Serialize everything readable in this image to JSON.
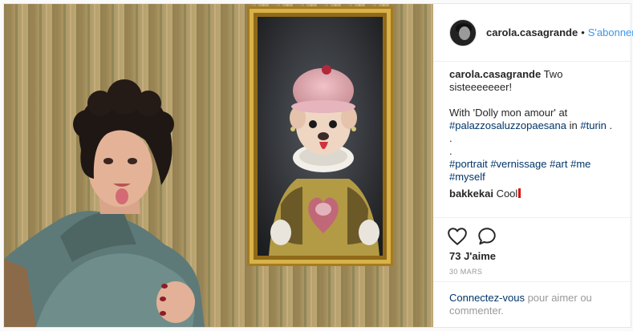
{
  "post": {
    "username": "carola.casagrande",
    "separator": "•",
    "follow_label": "S'abonner",
    "caption": {
      "username": "carola.casagrande",
      "text": "Two sisteeeeeeer!",
      "line2_prefix": "With 'Dolly mon amour' at",
      "tag_location": "#palazzosaluzzopaesana",
      "in_word": "in",
      "tag_city": "#turin",
      "period": ".",
      "dot1": ".",
      "dot2": ".",
      "hashtags": [
        "#portrait",
        "#vernissage",
        "#art",
        "#me",
        "#myself"
      ]
    },
    "comment": {
      "username": "bakkekai",
      "text": "Cool"
    },
    "likes": "73 J'aime",
    "date": "30 MARS",
    "login_prompt": {
      "link": "Connectez-vous",
      "rest": " pour aimer ou commenter."
    }
  },
  "icons": {
    "heart": "heart-icon",
    "comment": "comment-icon"
  },
  "colors": {
    "link_blue": "#3897f0",
    "hashtag": "#003569",
    "muted": "#999999"
  }
}
